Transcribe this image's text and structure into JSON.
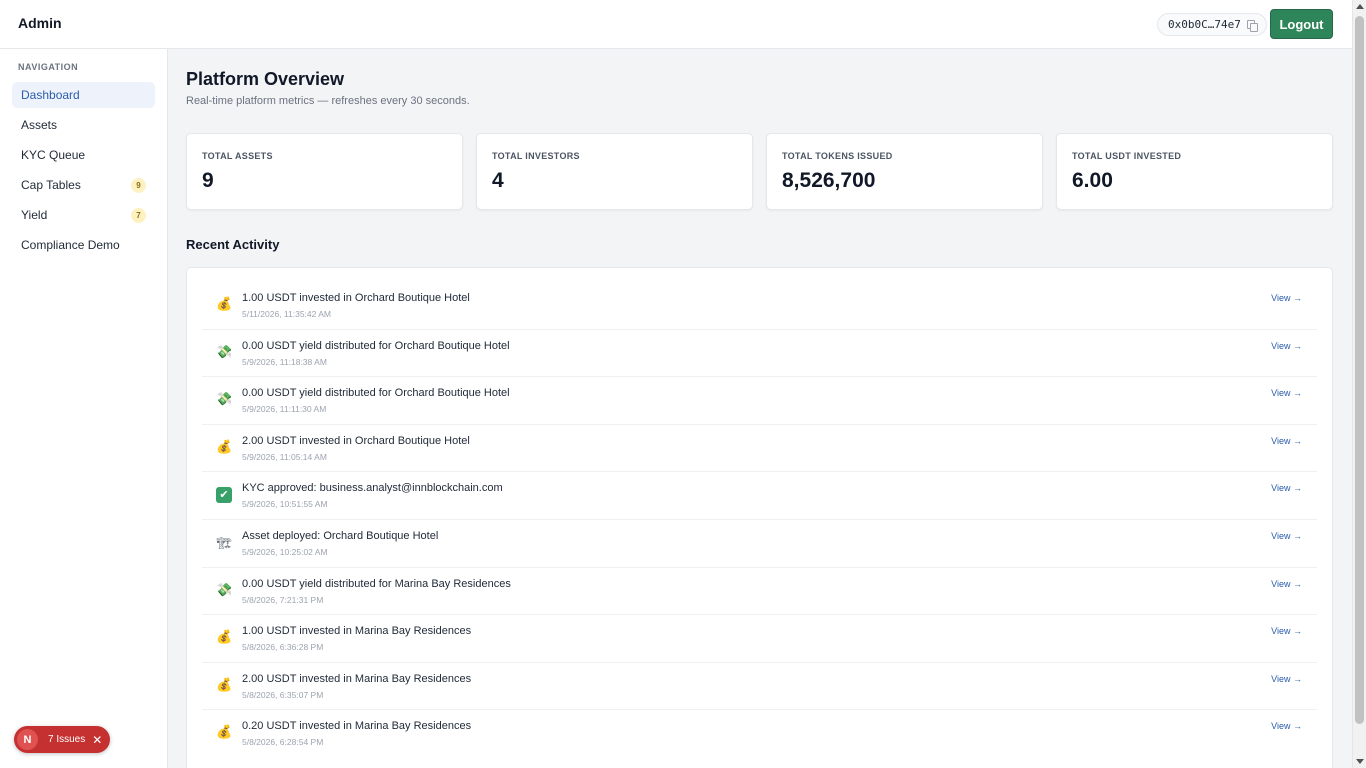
{
  "header": {
    "brand": "Admin",
    "wallet": "0x0b0C…74e7",
    "logout_label": "Logout"
  },
  "sidebar": {
    "heading": "NAVIGATION",
    "items": [
      {
        "label": "Dashboard",
        "badge": null,
        "active": true
      },
      {
        "label": "Assets",
        "badge": null
      },
      {
        "label": "KYC Queue",
        "badge": null
      },
      {
        "label": "Cap Tables",
        "badge": "9"
      },
      {
        "label": "Yield",
        "badge": "7"
      },
      {
        "label": "Compliance Demo",
        "badge": null
      }
    ]
  },
  "main": {
    "title": "Platform Overview",
    "subtitle": "Real-time platform metrics — refreshes every 30 seconds.",
    "stats": [
      {
        "label": "TOTAL ASSETS",
        "value": "9"
      },
      {
        "label": "TOTAL INVESTORS",
        "value": "4"
      },
      {
        "label": "TOTAL TOKENS ISSUED",
        "value": "8,526,700"
      },
      {
        "label": "TOTAL USDT INVESTED",
        "value": "6.00"
      }
    ],
    "activity_title": "Recent Activity",
    "activity": [
      {
        "icon": "money-bag-icon",
        "title": "1.00 USDT invested in Orchard Boutique Hotel",
        "time": "5/11/2026, 11:35:42 AM",
        "link": "View →"
      },
      {
        "icon": "money-wings-icon",
        "title": "0.00 USDT yield distributed for Orchard Boutique Hotel",
        "time": "5/9/2026, 11:18:38 AM",
        "link": "View →"
      },
      {
        "icon": "money-wings-icon",
        "title": "0.00 USDT yield distributed for Orchard Boutique Hotel",
        "time": "5/9/2026, 11:11:30 AM",
        "link": "View →"
      },
      {
        "icon": "money-bag-icon",
        "title": "2.00 USDT invested in Orchard Boutique Hotel",
        "time": "5/9/2026, 11:05:14 AM",
        "link": "View →"
      },
      {
        "icon": "check-mark-icon",
        "title": "KYC approved: business.analyst@innblockchain.com",
        "time": "5/9/2026, 10:51:55 AM",
        "link": "View →"
      },
      {
        "icon": "construction-icon",
        "title": "Asset deployed: Orchard Boutique Hotel",
        "time": "5/9/2026, 10:25:02 AM",
        "link": "View →"
      },
      {
        "icon": "money-wings-icon",
        "title": "0.00 USDT yield distributed for Marina Bay Residences",
        "time": "5/8/2026, 7:21:31 PM",
        "link": "View →"
      },
      {
        "icon": "money-bag-icon",
        "title": "1.00 USDT invested in Marina Bay Residences",
        "time": "5/8/2026, 6:36:28 PM",
        "link": "View →"
      },
      {
        "icon": "money-bag-icon",
        "title": "2.00 USDT invested in Marina Bay Residences",
        "time": "5/8/2026, 6:35:07 PM",
        "link": "View →"
      },
      {
        "icon": "money-bag-icon",
        "title": "0.20 USDT invested in Marina Bay Residences",
        "time": "5/8/2026, 6:28:54 PM",
        "link": "View →"
      }
    ]
  },
  "issues": {
    "badge": "N",
    "label": "7 Issues",
    "close": "✕"
  },
  "colors": {
    "accent": "#2f855a",
    "link": "#2b5cab",
    "badge_bg": "#fdf1c2",
    "issues_bg": "#c53030"
  }
}
